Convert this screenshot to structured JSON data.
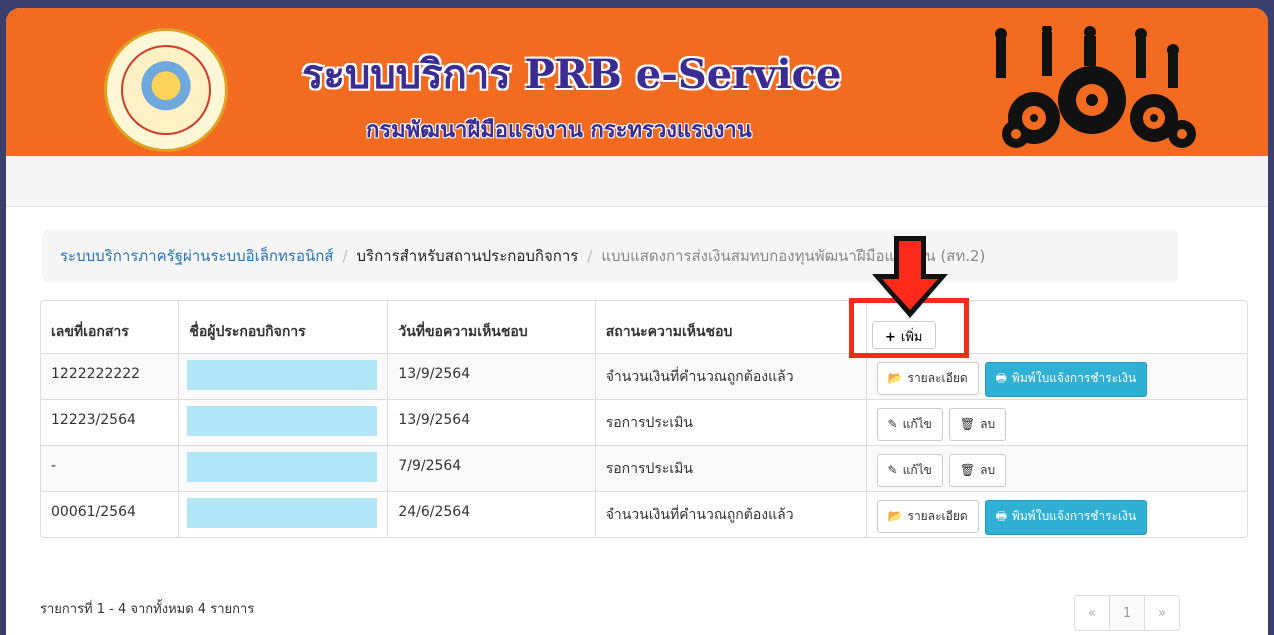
{
  "banner": {
    "title": "ระบบบริการ PRB e-Service",
    "subtitle": "กรมพัฒนาฝีมือแรงงาน กระทรวงแรงงาน"
  },
  "breadcrumb": {
    "items": [
      "ระบบบริการภาครัฐผ่านระบบอิเล็กทรอนิกส์",
      "บริการสำหรับสถานประกอบกิจการ",
      "แบบแสดงการส่งเงินสมทบกองทุนพัฒนาฝีมือแรงงาน (สท.2)"
    ],
    "separator": "/"
  },
  "table": {
    "headers": [
      "เลขที่เอกสาร",
      "ชื่อผู้ประกอบกิจการ",
      "วันที่ขอความเห็นชอบ",
      "สถานะความเห็นชอบ"
    ],
    "add_button": "เพิ่ม",
    "rows": [
      {
        "doc_no": "1222222222",
        "date": "13/9/2564",
        "status": "จำนวนเงินที่คำนวณถูกต้องแล้ว",
        "actions": [
          "detail",
          "print"
        ]
      },
      {
        "doc_no": "12223/2564",
        "date": "13/9/2564",
        "status": "รอการประเมิน",
        "actions": [
          "edit",
          "delete"
        ]
      },
      {
        "doc_no": "-",
        "date": "7/9/2564",
        "status": "รอการประเมิน",
        "actions": [
          "edit",
          "delete"
        ]
      },
      {
        "doc_no": "00061/2564",
        "date": "24/6/2564",
        "status": "จำนวนเงินที่คำนวณถูกต้องแล้ว",
        "actions": [
          "detail",
          "print"
        ]
      }
    ],
    "action_labels": {
      "detail": "รายละเอียด",
      "print": "พิมพ์ใบแจ้งการชำระเงิน",
      "edit": "แก้ไข",
      "delete": "ลบ"
    }
  },
  "footer": {
    "summary": "รายการที่ 1 - 4 จากทั้งหมด 4 รายการ"
  },
  "pagination": {
    "prev": "«",
    "current": "1",
    "next": "»"
  },
  "colors": {
    "banner": "#f26b21",
    "title": "#3b2c94",
    "link": "#2a72b5",
    "info_button": "#31b0d5",
    "annotation": "#ff2a1a",
    "redaction": "#b3e5f8"
  },
  "icons": {
    "add": "plus-icon",
    "detail": "folder-open-icon",
    "print": "printer-icon",
    "edit": "pencil-icon",
    "delete": "trash-icon"
  }
}
